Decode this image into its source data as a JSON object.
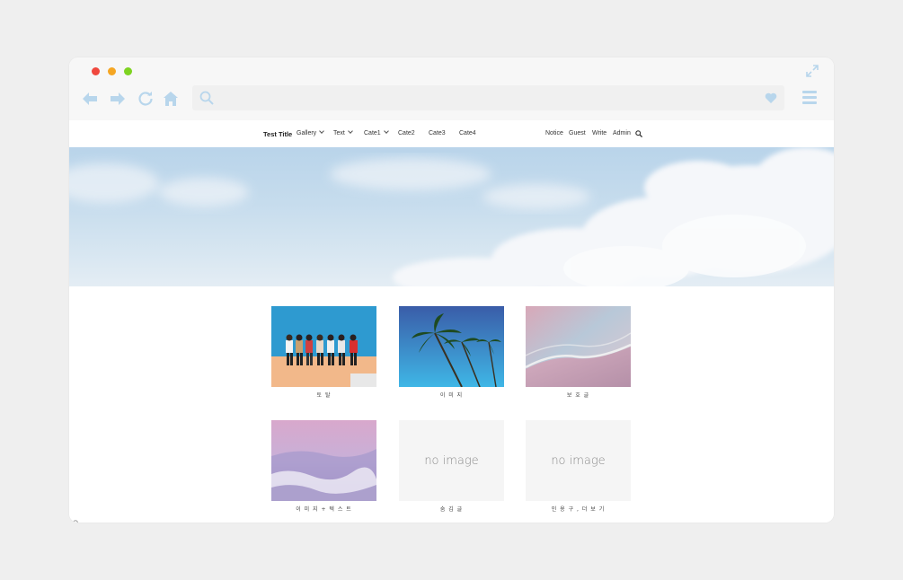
{
  "colors": {
    "icon_blue": "#b8d6ec",
    "dot_red": "#f0483e",
    "dot_yellow": "#f5a623",
    "dot_green": "#7ed321"
  },
  "address_bar": {
    "value": ""
  },
  "nav": {
    "title": "Test Title",
    "items": [
      {
        "label": "Gallery",
        "dropdown": true
      },
      {
        "label": "Text",
        "dropdown": true
      },
      {
        "label": "Cate1",
        "dropdown": true
      },
      {
        "label": "Cate2",
        "dropdown": false
      },
      {
        "label": "Cate3",
        "dropdown": false
      },
      {
        "label": "Cate4",
        "dropdown": false
      }
    ],
    "right_items": [
      "Notice",
      "Guest",
      "Write",
      "Admin"
    ]
  },
  "gallery": [
    {
      "caption": "토 탈"
    },
    {
      "caption": "이 미 지"
    },
    {
      "caption": "보 호 글"
    },
    {
      "caption": "이 미 지 + 텍 스 트"
    },
    {
      "caption": "숨 김 글",
      "no_image_text": "no image"
    },
    {
      "caption": "인 용 구 ,  더 보 기",
      "no_image_text": "no image"
    }
  ]
}
